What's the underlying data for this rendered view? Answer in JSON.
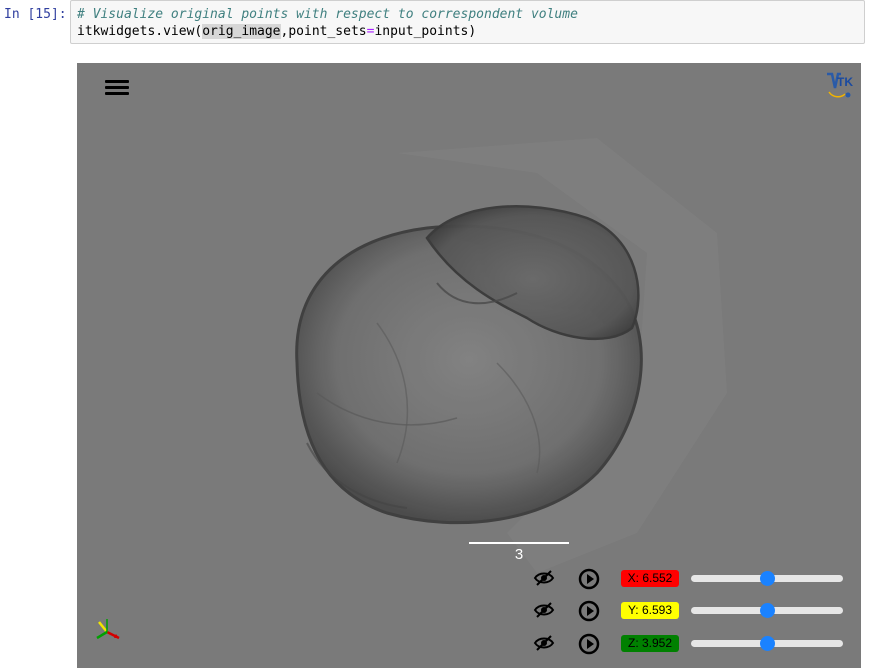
{
  "cell": {
    "prompt": "In [15]:",
    "comment": "# Visualize original points with respect to correspondent volume",
    "code_prefix": "itkwidgets.view(",
    "code_highlight": "orig_image",
    "code_mid": ",point_sets",
    "code_eq": "=",
    "code_suffix": "input_points)"
  },
  "viewer": {
    "background_color": "#7a7a7a",
    "menu_icon": "hamburger-menu-icon",
    "logo_icon": "itk-logo-icon",
    "scale_bar_label": "3",
    "axes_icon": "orientation-axes-icon",
    "slices": [
      {
        "axis": "X",
        "label": "X: 6.552",
        "color": "#ff0000",
        "position_fraction": 0.5
      },
      {
        "axis": "Y",
        "label": "Y: 6.593",
        "color": "#ffff00",
        "position_fraction": 0.5
      },
      {
        "axis": "Z",
        "label": "Z: 3.952",
        "color": "#008000",
        "position_fraction": 0.5
      }
    ]
  }
}
